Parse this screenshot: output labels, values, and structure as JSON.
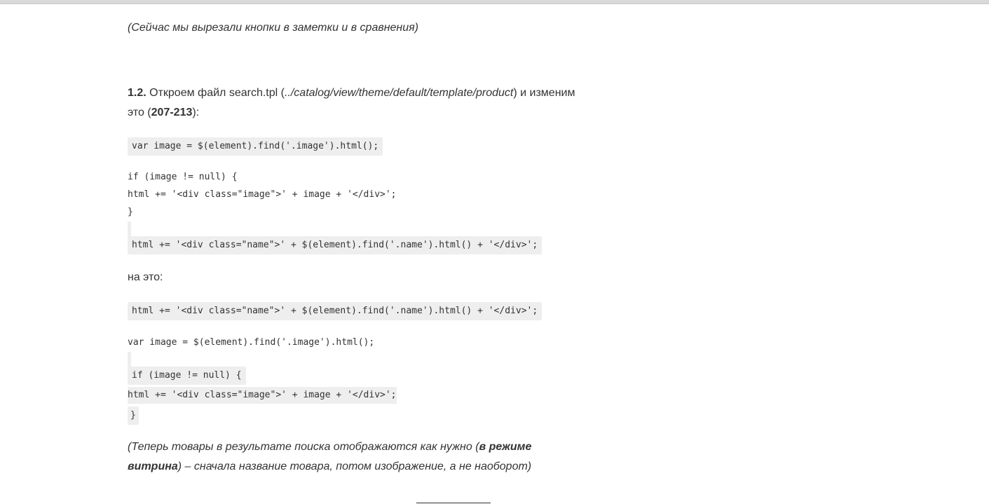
{
  "intro_note": "(Сейчас мы вырезали кнопки в заметки и в сравнения)",
  "step": {
    "number": "1.2.",
    "text_before_path": " Откроем файл search.tpl (",
    "path": "../catalog/view/theme/default/template/product",
    "text_after_path": ") и изменим",
    "line2_start": "это (",
    "lines_range": "207-213",
    "line2_end": "):"
  },
  "code_before": {
    "line1": "var image = $(element).find('.image').html();",
    "line2": "if (image != null) {",
    "line3": "html += '<div class=\"image\">' + image + '</div>';",
    "line4": "}",
    "line5": "html += '<div class=\"name\">' + $(element).find('.name').html() + '</div>';"
  },
  "to_this_label": "на это:",
  "code_after": {
    "line1": "html += '<div class=\"name\">' + $(element).find('.name').html() + '</div>';",
    "line2": "var image = $(element).find('.image').html();",
    "line3": "if (image != null) {",
    "line4": "html += '<div class=\"image\">' + image + '</div>';",
    "line5": "}"
  },
  "result_note": {
    "open": "(",
    "part1": "Теперь товары в результате поиска отображаются как нужно (",
    "bold1": "в режиме",
    "bold2": "витрина",
    "part2": ") – сначала название товара, потом изображение, а не наоборот",
    "close": ")"
  }
}
